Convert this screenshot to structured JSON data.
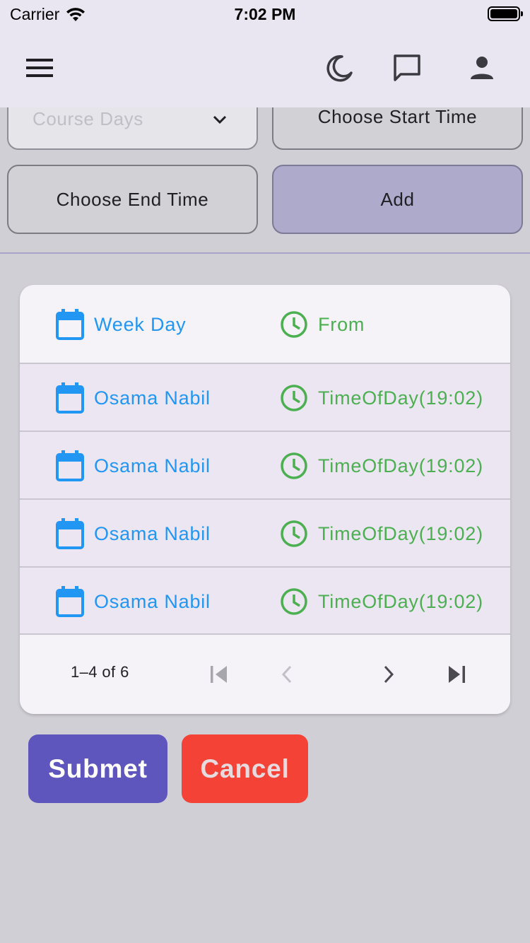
{
  "status_bar": {
    "carrier": "Carrier",
    "time": "7:02 PM"
  },
  "app_bar": {
    "icons": [
      "menu-icon",
      "moon-icon",
      "chat-icon",
      "person-icon"
    ]
  },
  "form": {
    "course_days_placeholder": "Course Days",
    "start_time_label": "Choose Start Time",
    "end_time_label": "Choose End Time",
    "add_label": "Add"
  },
  "table": {
    "headers": {
      "day": "Week Day",
      "from": "From"
    },
    "rows": [
      {
        "day": "Osama Nabil",
        "time": "TimeOfDay(19:02)"
      },
      {
        "day": "Osama Nabil",
        "time": "TimeOfDay(19:02)"
      },
      {
        "day": "Osama Nabil",
        "time": "TimeOfDay(19:02)"
      },
      {
        "day": "Osama Nabil",
        "time": "TimeOfDay(19:02)"
      }
    ],
    "pagination": "1–4 of 6"
  },
  "actions": {
    "submit_label": "Submet",
    "cancel_label": "Cancel"
  },
  "colors": {
    "accent_blue": "#2196f3",
    "accent_green": "#4caf50",
    "submit_bg": "#5e55bd",
    "cancel_bg": "#f44336",
    "add_bg": "#adaacb"
  }
}
